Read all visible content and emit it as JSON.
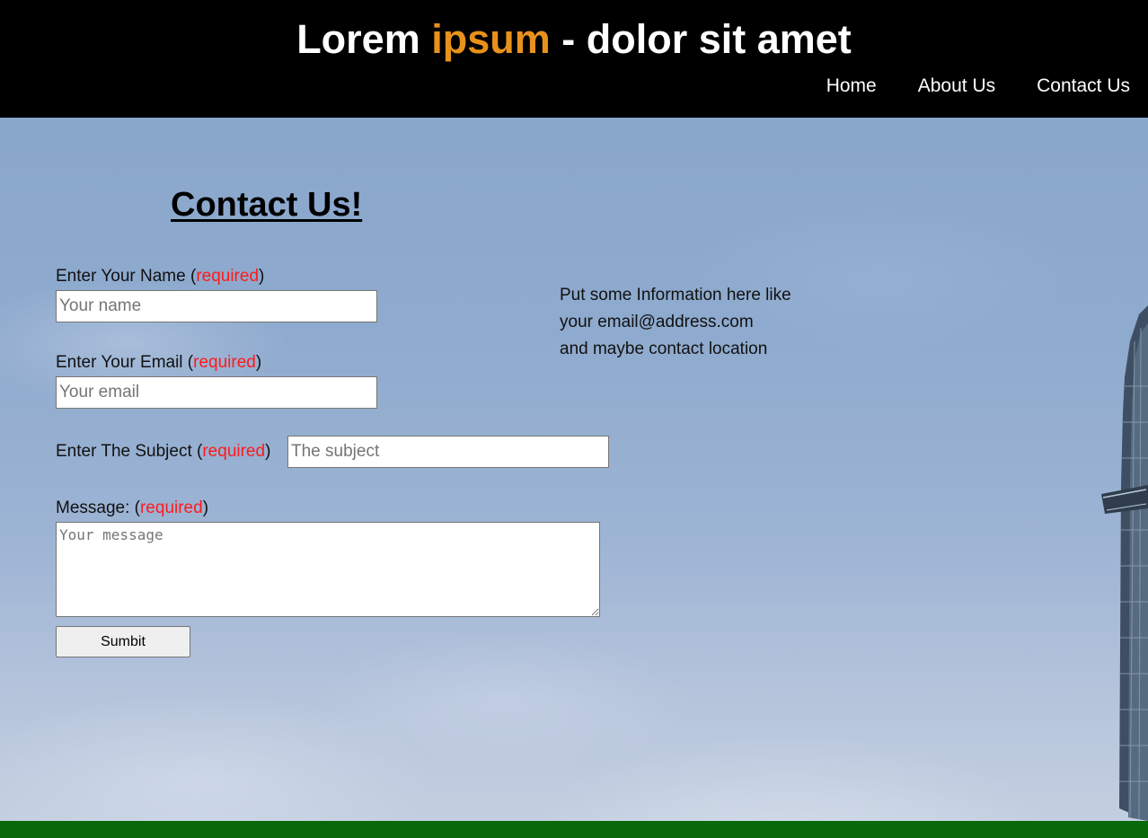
{
  "header": {
    "title_part1": "Lorem ",
    "title_accent": "ipsum",
    "title_part2": " - dolor sit amet",
    "nav": {
      "home": "Home",
      "about": "About Us",
      "contact": "Contact Us"
    }
  },
  "form": {
    "heading": "Contact Us!",
    "name": {
      "label": "Enter Your Name (",
      "required": "required",
      "close": ")",
      "placeholder": "Your name",
      "value": ""
    },
    "email": {
      "label": "Enter Your Email (",
      "required": "required",
      "close": ")",
      "placeholder": "Your email",
      "value": ""
    },
    "subject": {
      "label": "Enter The Subject (",
      "required": "required",
      "close": ")",
      "placeholder": "The subject",
      "value": ""
    },
    "message": {
      "label": "Message: (",
      "required": "required",
      "close": ")",
      "placeholder": "Your message",
      "value": ""
    },
    "submit_label": "Sumbit"
  },
  "info": {
    "line1": "Put some Information here like",
    "line2": "your email@address.com",
    "line3": "and maybe contact location"
  },
  "colors": {
    "header_bg": "#000000",
    "accent": "#e8911c",
    "required": "#ff1a1a",
    "footer_bar": "#08680a"
  }
}
